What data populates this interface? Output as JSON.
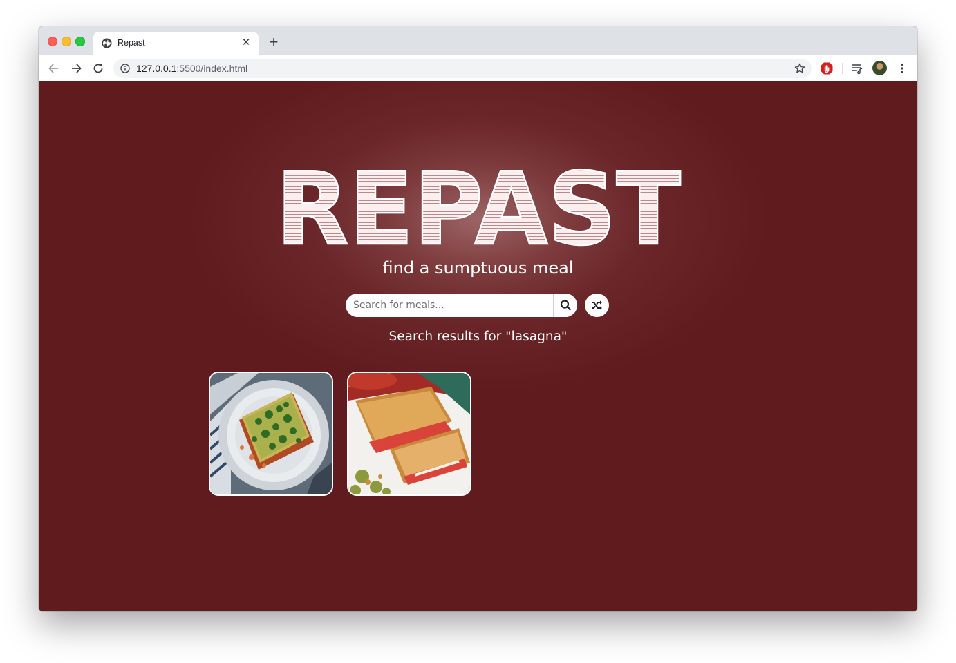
{
  "browser": {
    "tab_title": "Repast",
    "url_host": "127.0.0.1",
    "url_rest": ":5500/index.html"
  },
  "page": {
    "logo_text": "REPAST",
    "tagline": "find a sumptuous meal",
    "search": {
      "placeholder": "Search for meals...",
      "value": ""
    },
    "results_heading": "Search results for \"lasagna\"",
    "meals": [
      {
        "image": "lasagna-plate-image"
      },
      {
        "image": "grilled-sandwich-image"
      }
    ]
  },
  "colors": {
    "page_background": "#5f1b1d",
    "glow": "#9c6466",
    "text": "#ffffff"
  }
}
